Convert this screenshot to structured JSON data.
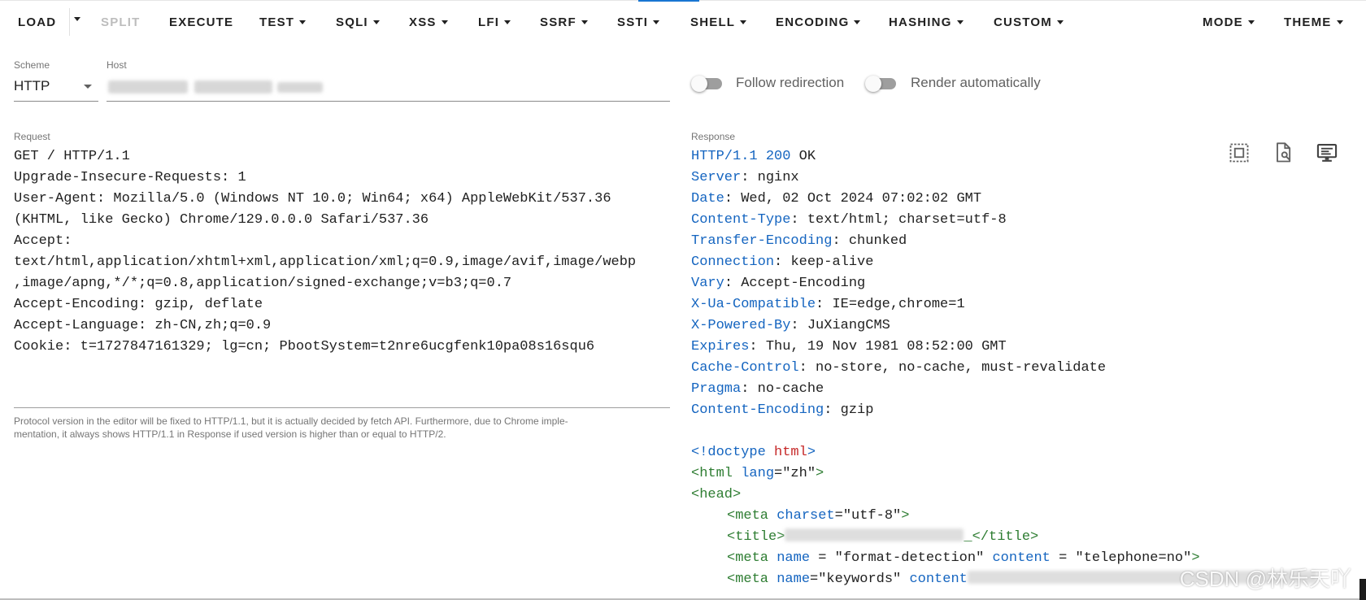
{
  "toolbar": {
    "load": "LOAD",
    "split": "SPLIT",
    "execute": "EXECUTE",
    "test": "TEST",
    "sqli": "SQLI",
    "xss": "XSS",
    "lfi": "LFI",
    "ssrf": "SSRF",
    "ssti": "SSTI",
    "shell": "SHELL",
    "encoding": "ENCODING",
    "hashing": "HASHING",
    "custom": "CUSTOM",
    "mode": "MODE",
    "theme": "THEME"
  },
  "scheme": {
    "label": "Scheme",
    "value": "HTTP"
  },
  "host": {
    "label": "Host",
    "value": ""
  },
  "options": {
    "follow_redirection": {
      "label": "Follow redirection",
      "enabled": false
    },
    "render_automatically": {
      "label": "Render automatically",
      "enabled": false
    }
  },
  "request": {
    "label": "Request",
    "lines": [
      "GET / HTTP/1.1",
      "Upgrade-Insecure-Requests: 1",
      "User-Agent: Mozilla/5.0 (Windows NT 10.0; Win64; x64) AppleWebKit/537.36",
      "(KHTML, like Gecko) Chrome/129.0.0.0 Safari/537.36",
      "Accept:",
      "text/html,application/xhtml+xml,application/xml;q=0.9,image/avif,image/webp",
      ",image/apng,*/*;q=0.8,application/signed-exchange;v=b3;q=0.7",
      "Accept-Encoding: gzip, deflate",
      "Accept-Language: zh-CN,zh;q=0.9",
      "Cookie: t=1727847161329; lg=cn; PbootSystem=t2nre6ucgfenk10pa08s16squ6"
    ],
    "hint_line1": "Protocol version in the editor will be fixed to HTTP/1.1, but it is actually decided by fetch API. Furthermore, due to Chrome imple-",
    "hint_line2": "mentation, it always shows HTTP/1.1 in Response if used version is higher than or equal to HTTP/2."
  },
  "response": {
    "label": "Response",
    "status": {
      "version": "HTTP/1.1",
      "code": "200",
      "text": "OK"
    },
    "headers": [
      {
        "name": "Server",
        "value": "nginx"
      },
      {
        "name": "Date",
        "value": "Wed, 02 Oct 2024 07:02:02 GMT"
      },
      {
        "name": "Content-Type",
        "value": "text/html; charset=utf-8"
      },
      {
        "name": "Transfer-Encoding",
        "value": "chunked"
      },
      {
        "name": "Connection",
        "value": "keep-alive"
      },
      {
        "name": "Vary",
        "value": "Accept-Encoding"
      },
      {
        "name": "X-Ua-Compatible",
        "value": "IE=edge,chrome=1"
      },
      {
        "name": "X-Powered-By",
        "value": "JuXiangCMS"
      },
      {
        "name": "Expires",
        "value": "Thu, 19 Nov 1981 08:52:00 GMT"
      },
      {
        "name": "Cache-Control",
        "value": "no-store, no-cache, must-revalidate"
      },
      {
        "name": "Pragma",
        "value": "no-cache"
      },
      {
        "name": "Content-Encoding",
        "value": "gzip"
      }
    ],
    "body": {
      "doctype_open": "<!doctype",
      "doctype_word": "html",
      "doctype_close": ">",
      "html_open": "<html",
      "html_lang_attr": "lang",
      "html_lang_val": "=\"zh\"",
      "gt": ">",
      "head_open": "<head>",
      "meta_open": "<meta",
      "meta_charset_attr": "charset",
      "meta_charset_val": "=\"utf-8\"",
      "title_open": "<title>",
      "title_close": "_</title>",
      "meta_name_attr": "name",
      "meta_name_val": " = \"format-detection\" ",
      "meta_content_attr": "content",
      "meta_content_val": " = \"telephone=no\"",
      "meta_kw_name_val": "=\"keywords\" ",
      "meta_kw_content_attr": "content"
    },
    "icons": {
      "render": "select-all-icon",
      "preview": "find-in-page-icon",
      "screen": "monitor-icon"
    }
  },
  "watermark": "CSDN @林乐天吖",
  "colors": {
    "header_name": "#1565c0",
    "tag": "#2e7d32",
    "keyword": "#c62828",
    "accent": "#1976d2"
  }
}
